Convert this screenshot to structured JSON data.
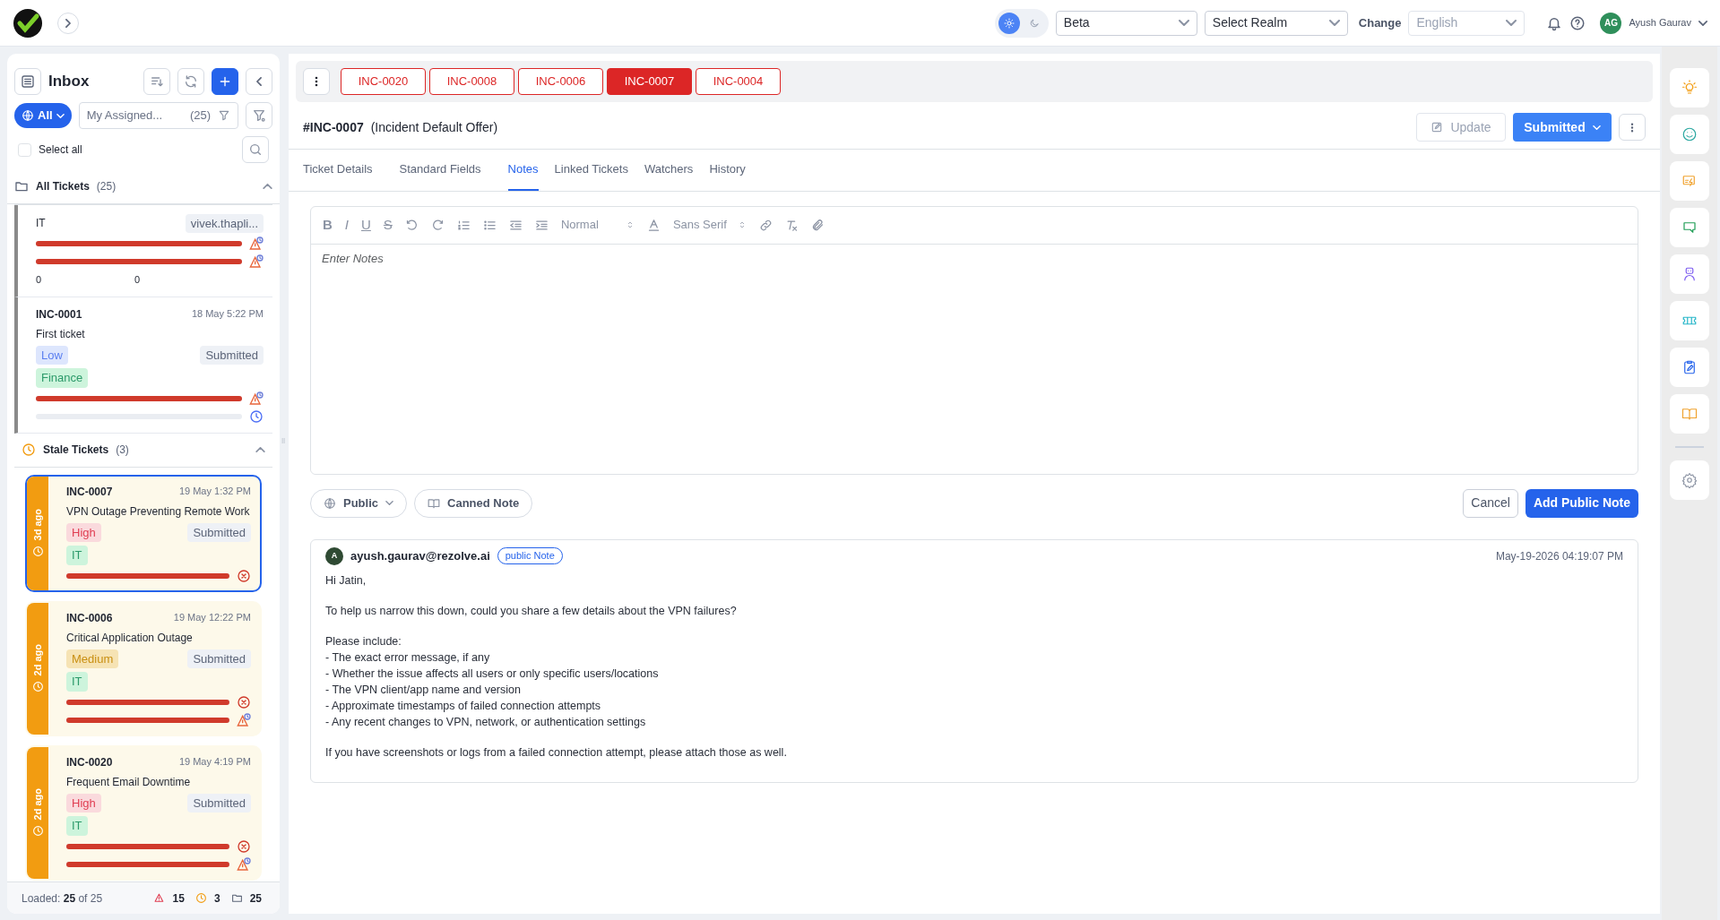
{
  "topbar": {
    "theme_options": [
      {
        "kind": "light",
        "selected": true
      },
      {
        "kind": "dark",
        "selected": false
      }
    ],
    "environment": "Beta",
    "realm_placeholder": "Select Realm",
    "change_label": "Change",
    "language": {
      "value": "English",
      "disabled": true
    },
    "user": {
      "initials": "AG",
      "name": "Ayush Gaurav"
    }
  },
  "inbox": {
    "title": "Inbox",
    "scope": "All",
    "assigned_filter": {
      "label": "My Assigned...",
      "count": "(25)"
    },
    "select_all": {
      "label": "Select all",
      "checked": false
    },
    "groups": [
      {
        "kind": "folder",
        "title": "All Tickets",
        "count": "(25)",
        "expanded": true,
        "tickets": [
          {
            "team": "IT",
            "assignee": "vivek.thapli...",
            "selected": false,
            "slas": [
              {
                "level": 1,
                "kind": "warning-clock"
              },
              {
                "level": 1,
                "kind": "warning-clock"
              }
            ],
            "counters": [
              "0",
              "0"
            ]
          },
          {
            "id": "INC-0001",
            "time": "18 May 5:22 PM",
            "subject": "First ticket",
            "priority": {
              "label": "Low",
              "kind": "low"
            },
            "status": "Submitted",
            "category": "Finance",
            "selected": false,
            "slas": [
              {
                "level": 1,
                "kind": "warning-clock"
              },
              {
                "kind": "clock"
              }
            ]
          }
        ]
      },
      {
        "kind": "clock",
        "title": "Stale Tickets",
        "count": "(3)",
        "expanded": true,
        "tickets": [
          {
            "age": "3d ago",
            "id": "INC-0007",
            "time": "19 May 1:32 PM",
            "subject": "VPN Outage Preventing Remote Work",
            "priority": {
              "label": "High",
              "kind": "high"
            },
            "status": "Submitted",
            "category": "IT",
            "selected": true,
            "slas": [
              {
                "level": 1,
                "kind": "x-circle"
              }
            ]
          },
          {
            "age": "2d ago",
            "id": "INC-0006",
            "time": "19 May 12:22 PM",
            "subject": "Critical Application Outage",
            "priority": {
              "label": "Medium",
              "kind": "medium"
            },
            "status": "Submitted",
            "category": "IT",
            "selected": false,
            "slas": [
              {
                "level": 1,
                "kind": "x-circle"
              },
              {
                "level": 1,
                "kind": "warning-clock"
              }
            ]
          },
          {
            "age": "2d ago",
            "id": "INC-0020",
            "time": "19 May 4:19 PM",
            "subject": "Frequent Email Downtime",
            "priority": {
              "label": "High",
              "kind": "high"
            },
            "status": "Submitted",
            "category": "IT",
            "selected": false,
            "slas": [
              {
                "level": 1,
                "kind": "x-circle"
              },
              {
                "level": 1,
                "kind": "warning-clock"
              }
            ]
          }
        ]
      }
    ],
    "footer": {
      "loaded_label": "Loaded:",
      "loaded": "25",
      "loaded_total": "of 25",
      "breached": "15",
      "stale": "3",
      "total": "25"
    }
  },
  "open_tickets": [
    {
      "label": "INC-0020",
      "selected": false
    },
    {
      "label": "INC-0008",
      "selected": false
    },
    {
      "label": "INC-0006",
      "selected": false
    },
    {
      "label": "INC-0007",
      "selected": true
    },
    {
      "label": "INC-0004",
      "selected": false
    }
  ],
  "ticket": {
    "number": "#INC-0007",
    "offer": "(Incident Default Offer)",
    "update": {
      "label": "Update",
      "disabled": true
    },
    "status": "Submitted"
  },
  "detail_tabs": [
    {
      "label": "Ticket Details",
      "selected": false
    },
    {
      "label": "Standard Fields",
      "selected": false
    },
    {
      "label": "Notes",
      "selected": true
    },
    {
      "label": "Linked Tickets",
      "selected": false
    },
    {
      "label": "Watchers",
      "selected": false
    },
    {
      "label": "History",
      "selected": false
    }
  ],
  "editor": {
    "toolbar": [
      {
        "kind": "bold",
        "glyph": "B"
      },
      {
        "kind": "italic",
        "glyph": "I"
      },
      {
        "kind": "underline",
        "glyph": "U"
      },
      {
        "kind": "strike",
        "glyph": "S"
      },
      {
        "kind": "undo"
      },
      {
        "kind": "redo"
      },
      {
        "kind": "ordered-list"
      },
      {
        "kind": "bullet-list"
      },
      {
        "kind": "outdent"
      },
      {
        "kind": "indent"
      },
      {
        "kind": "select",
        "value": "Normal"
      },
      {
        "kind": "text-color"
      },
      {
        "kind": "select",
        "value": "Sans Serif"
      },
      {
        "kind": "link"
      },
      {
        "kind": "clear-format"
      },
      {
        "kind": "attach"
      }
    ],
    "placeholder": "Enter Notes"
  },
  "note_actions": {
    "visibility": "Public",
    "canned": "Canned Note",
    "cancel": "Cancel",
    "submit": "Add Public Note"
  },
  "notes": [
    {
      "avatar": "A",
      "author": "ayush.gaurav@rezolve.ai",
      "badge": "public Note",
      "time": "May-19-2026 04:19:07 PM",
      "paragraphs": [
        [
          "Hi Jatin,"
        ],
        [
          "To help us narrow this down, could you share a few details about the VPN failures?"
        ],
        [
          "Please include:",
          "- The exact error message, if any",
          "- Whether the issue affects all users or only specific users/locations",
          "- The VPN client/app name and version",
          "- Approximate timestamps of failed connection attempts",
          "- Any recent changes to VPN, network, or authentication settings"
        ],
        [
          "If you have screenshots or logs from a failed connection attempt, please attach those as well."
        ]
      ]
    }
  ]
}
